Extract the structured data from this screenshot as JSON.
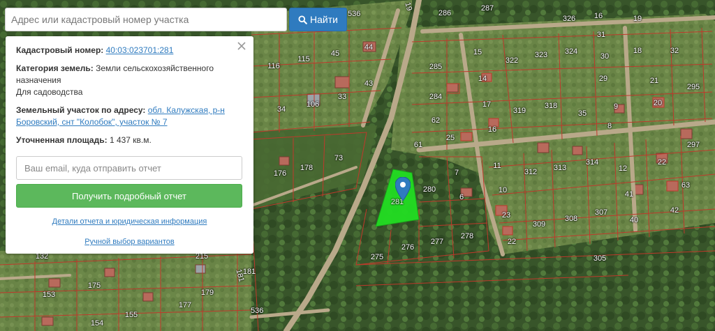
{
  "search": {
    "placeholder": "Адрес или кадастровый номер участка",
    "button_label": "Найти",
    "button_icon": "search-icon"
  },
  "info": {
    "cadastral_label": "Кадастровый номер:",
    "cadastral_value": "40:03:023701:281",
    "category_label": "Категория земель:",
    "category_value": "Земли сельскохозяйственного назначения",
    "usage_value": "Для садоводства",
    "address_label": "Земельный участок по адресу:",
    "address_value": "обл. Калужская, р-н Боровский, снт \"Колобок\", участок № 7",
    "area_label": "Уточненная площадь:",
    "area_value": "1 437 кв.м.",
    "email_placeholder": "Ваш email, куда отправить отчет",
    "report_button": "Получить подробный отчет",
    "details_link": "Детали отчета и юридическая информация",
    "manual_link": "Ручной выбор вариантов",
    "close_icon": "close-icon"
  },
  "map": {
    "selected_plot_label": "281",
    "marker_icon": "map-marker-icon",
    "road_labels": [
      "536",
      "536",
      "19",
      "181"
    ],
    "plot_labels": [
      "286",
      "287",
      "326",
      "19",
      "15",
      "31",
      "16",
      "322",
      "323",
      "324",
      "32",
      "30",
      "18",
      "285",
      "14",
      "29",
      "21",
      "295",
      "116",
      "115",
      "45",
      "44",
      "43",
      "284",
      "17",
      "319",
      "318",
      "35",
      "9",
      "20",
      "34",
      "106",
      "33",
      "62",
      "16",
      "8",
      "25",
      "297",
      "61",
      "73",
      "176",
      "178",
      "11",
      "312",
      "313",
      "314",
      "12",
      "22",
      "7",
      "280",
      "10",
      "41",
      "63",
      "6",
      "42",
      "23",
      "309",
      "308",
      "307",
      "40",
      "278",
      "276",
      "277",
      "22",
      "275",
      "305",
      "132",
      "175",
      "215",
      "181",
      "153",
      "179",
      "155",
      "177",
      "154"
    ],
    "colors": {
      "parcel_border": "#c0392b",
      "selected_fill": "#22dd22",
      "marker": "#2f7bbf"
    }
  }
}
